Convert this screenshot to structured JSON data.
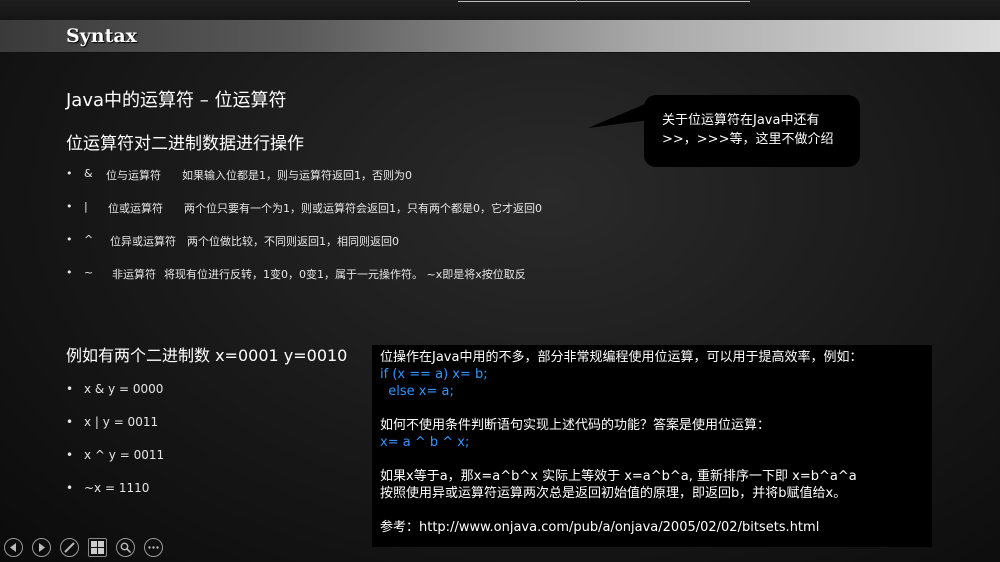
{
  "slide": {
    "title": "Syntax",
    "heading": "Java中的运算符 – 位运算符",
    "sub_heading": "位运算符对二进制数据进行操作",
    "callout": {
      "line1": "关于位运算符在Java中还有",
      "line2": ">>，>>>等，这里不做介绍"
    },
    "operators": [
      {
        "bullet": "•",
        "symbol": "&",
        "name": "位与运算符",
        "desc": "如果输入位都是1，则与运算符返回1，否则为0"
      },
      {
        "bullet": "•",
        "symbol": "|",
        "name": "位或运算符",
        "desc": "两个位只要有一个为1，则或运算符会返回1，只有两个都是0，它才返回0"
      },
      {
        "bullet": "•",
        "symbol": "^",
        "name": "位异或运算符",
        "desc": "两个位做比较，不同则返回1，相同则返回0"
      },
      {
        "bullet": "•",
        "symbol": "~",
        "name": "非运算符",
        "desc": "将现有位进行反转，1变0，0变1，属于一元操作符。 ~x即是将x按位取反"
      }
    ],
    "example_heading": "例如有两个二进制数 x=0001 y=0010",
    "examples": [
      {
        "bullet": "•",
        "text": "x & y = 0000"
      },
      {
        "bullet": "•",
        "text": "x | y = 0011"
      },
      {
        "bullet": "•",
        "text": "x ^ y = 0011"
      },
      {
        "bullet": "•",
        "text": "~x = 1110"
      }
    ],
    "code_box": {
      "line1": "位操作在Java中用的不多，部分非常规编程使用位运算，可以用于提高效率，例如：",
      "code1": "if (x == a) x= b;",
      "code2": "  else x= a;",
      "line2": "如何不使用条件判断语句实现上述代码的功能？答案是使用位运算：",
      "code3": "x= a ^ b ^ x;",
      "line3": "如果x等于a，那x=a^b^x 实际上等效于 x=a^b^a, 重新排序一下即 x=b^a^a",
      "line4": "按照使用异或运算符运算两次总是返回初始值的原理，即返回b，并将b赋值给x。",
      "reference": "参考：http://www.onjava.com/pub/a/onjava/2005/02/02/bitsets.html"
    }
  },
  "toolbar": {
    "buttons": [
      "previous-slide-icon",
      "next-slide-icon",
      "pen-icon",
      "slides-grid-icon",
      "zoom-icon",
      "more-options-icon"
    ]
  },
  "colors": {
    "code_blue": "#2f95ff",
    "box_black": "#000000"
  }
}
